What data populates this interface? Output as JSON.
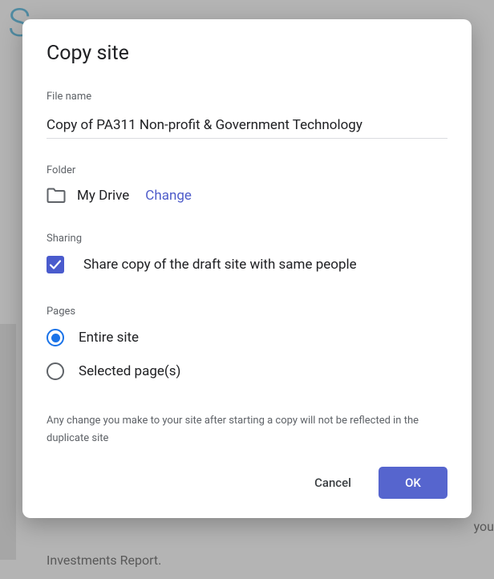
{
  "dialog": {
    "title": "Copy site",
    "file_name_label": "File name",
    "file_name_value": "Copy of PA311 Non-profit & Government Technology",
    "folder_label": "Folder",
    "folder_name": "My Drive",
    "change_link": "Change",
    "sharing_label": "Sharing",
    "share_checkbox_label": "Share copy of the draft site with same people",
    "share_checked": true,
    "pages_label": "Pages",
    "pages_options": {
      "entire": "Entire site",
      "selected": "Selected page(s)"
    },
    "pages_selected": "entire",
    "disclaimer": "Any change you make to your site after starting a copy will not be reflected in the duplicate site",
    "cancel_label": "Cancel",
    "ok_label": "OK"
  },
  "background": {
    "top_letter": "S",
    "right_text": "you",
    "bottom_text": "Investments Report."
  }
}
